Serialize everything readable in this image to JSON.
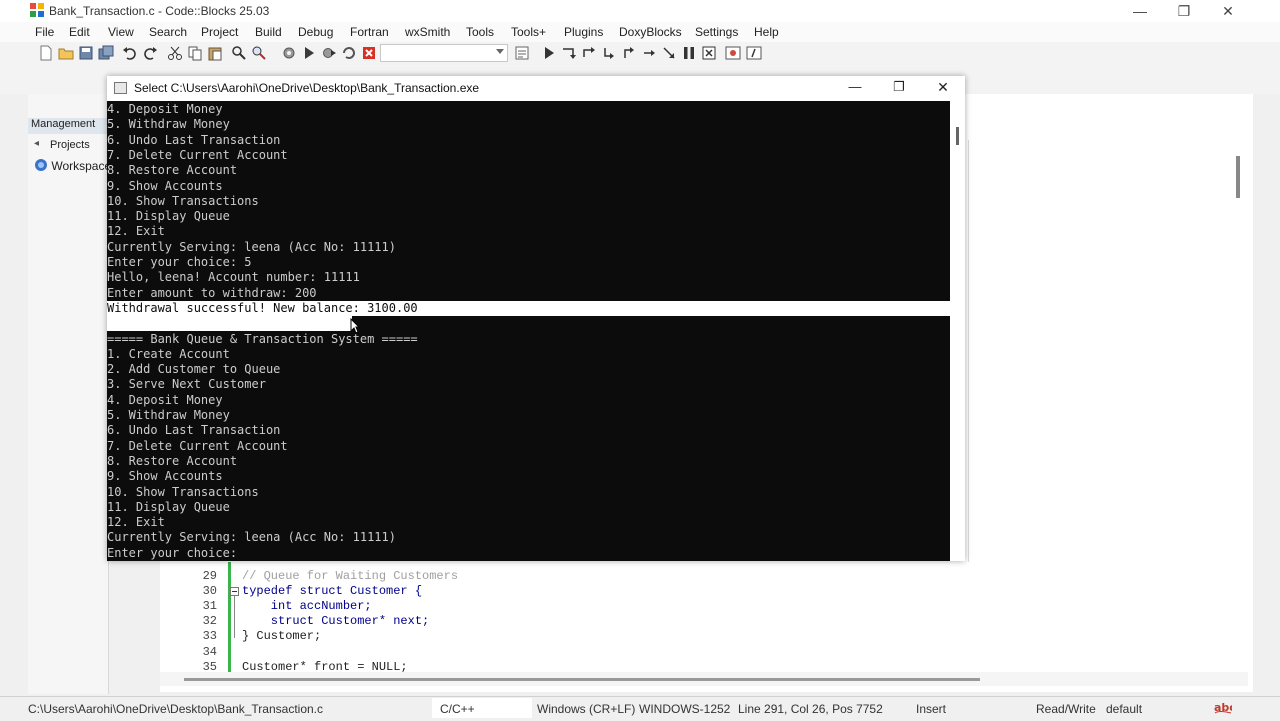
{
  "window": {
    "title": "Bank_Transaction.c - Code::Blocks 25.03",
    "minimize": "—",
    "maximize": "❐",
    "close": "✕"
  },
  "menu": [
    "File",
    "Edit",
    "View",
    "Search",
    "Project",
    "Build",
    "Debug",
    "Fortran",
    "wxSmith",
    "Tools",
    "Tools+",
    "Plugins",
    "DoxyBlocks",
    "Settings",
    "Help"
  ],
  "left_panel": {
    "management": "Management",
    "projects_tab": "Projects",
    "workspace": "Workspace"
  },
  "console": {
    "title": "Select C:\\Users\\Aarohi\\OneDrive\\Desktop\\Bank_Transaction.exe",
    "lines": [
      "4. Deposit Money",
      "5. Withdraw Money",
      "6. Undo Last Transaction",
      "7. Delete Current Account",
      "8. Restore Account",
      "9. Show Accounts",
      "10. Show Transactions",
      "11. Display Queue",
      "12. Exit",
      "Currently Serving: leena (Acc No: 11111)",
      "Enter your choice: 5",
      "Hello, leena! Account number: 11111",
      "Enter amount to withdraw: 200",
      "Withdrawal successful! New balance: 3100.00",
      "",
      "===== Bank Queue & Transaction System =====",
      "1. Create Account",
      "2. Add Customer to Queue",
      "3. Serve Next Customer",
      "4. Deposit Money",
      "5. Withdraw Money",
      "6. Undo Last Transaction",
      "7. Delete Current Account",
      "8. Restore Account",
      "9. Show Accounts",
      "10. Show Transactions",
      "11. Display Queue",
      "12. Exit",
      "Currently Serving: leena (Acc No: 11111)",
      "Enter your choice:"
    ]
  },
  "editor": {
    "line_numbers": [
      "29",
      "30",
      "31",
      "32",
      "33",
      "34",
      "35"
    ],
    "code": [
      "// Queue for Waiting Customers",
      "typedef struct Customer {",
      "    int accNumber;",
      "    struct Customer* next;",
      "} Customer;",
      "",
      "Customer* front = NULL;"
    ]
  },
  "status": {
    "path": "C:\\Users\\Aarohi\\OneDrive\\Desktop\\Bank_Transaction.c",
    "language": "C/C++",
    "line_endings": "Windows (CR+LF)",
    "encoding": "WINDOWS-1252",
    "position": "Line 291, Col 26, Pos 7752",
    "mode": "Insert",
    "access": "Read/Write",
    "profile": "default"
  },
  "colors": {
    "console_bg": "#0c0c0c",
    "console_text": "#cccccc",
    "selection": "#ffffff",
    "comment": "#a0a0a0",
    "keyword": "#00008b",
    "change_bar": "#39b54a"
  }
}
